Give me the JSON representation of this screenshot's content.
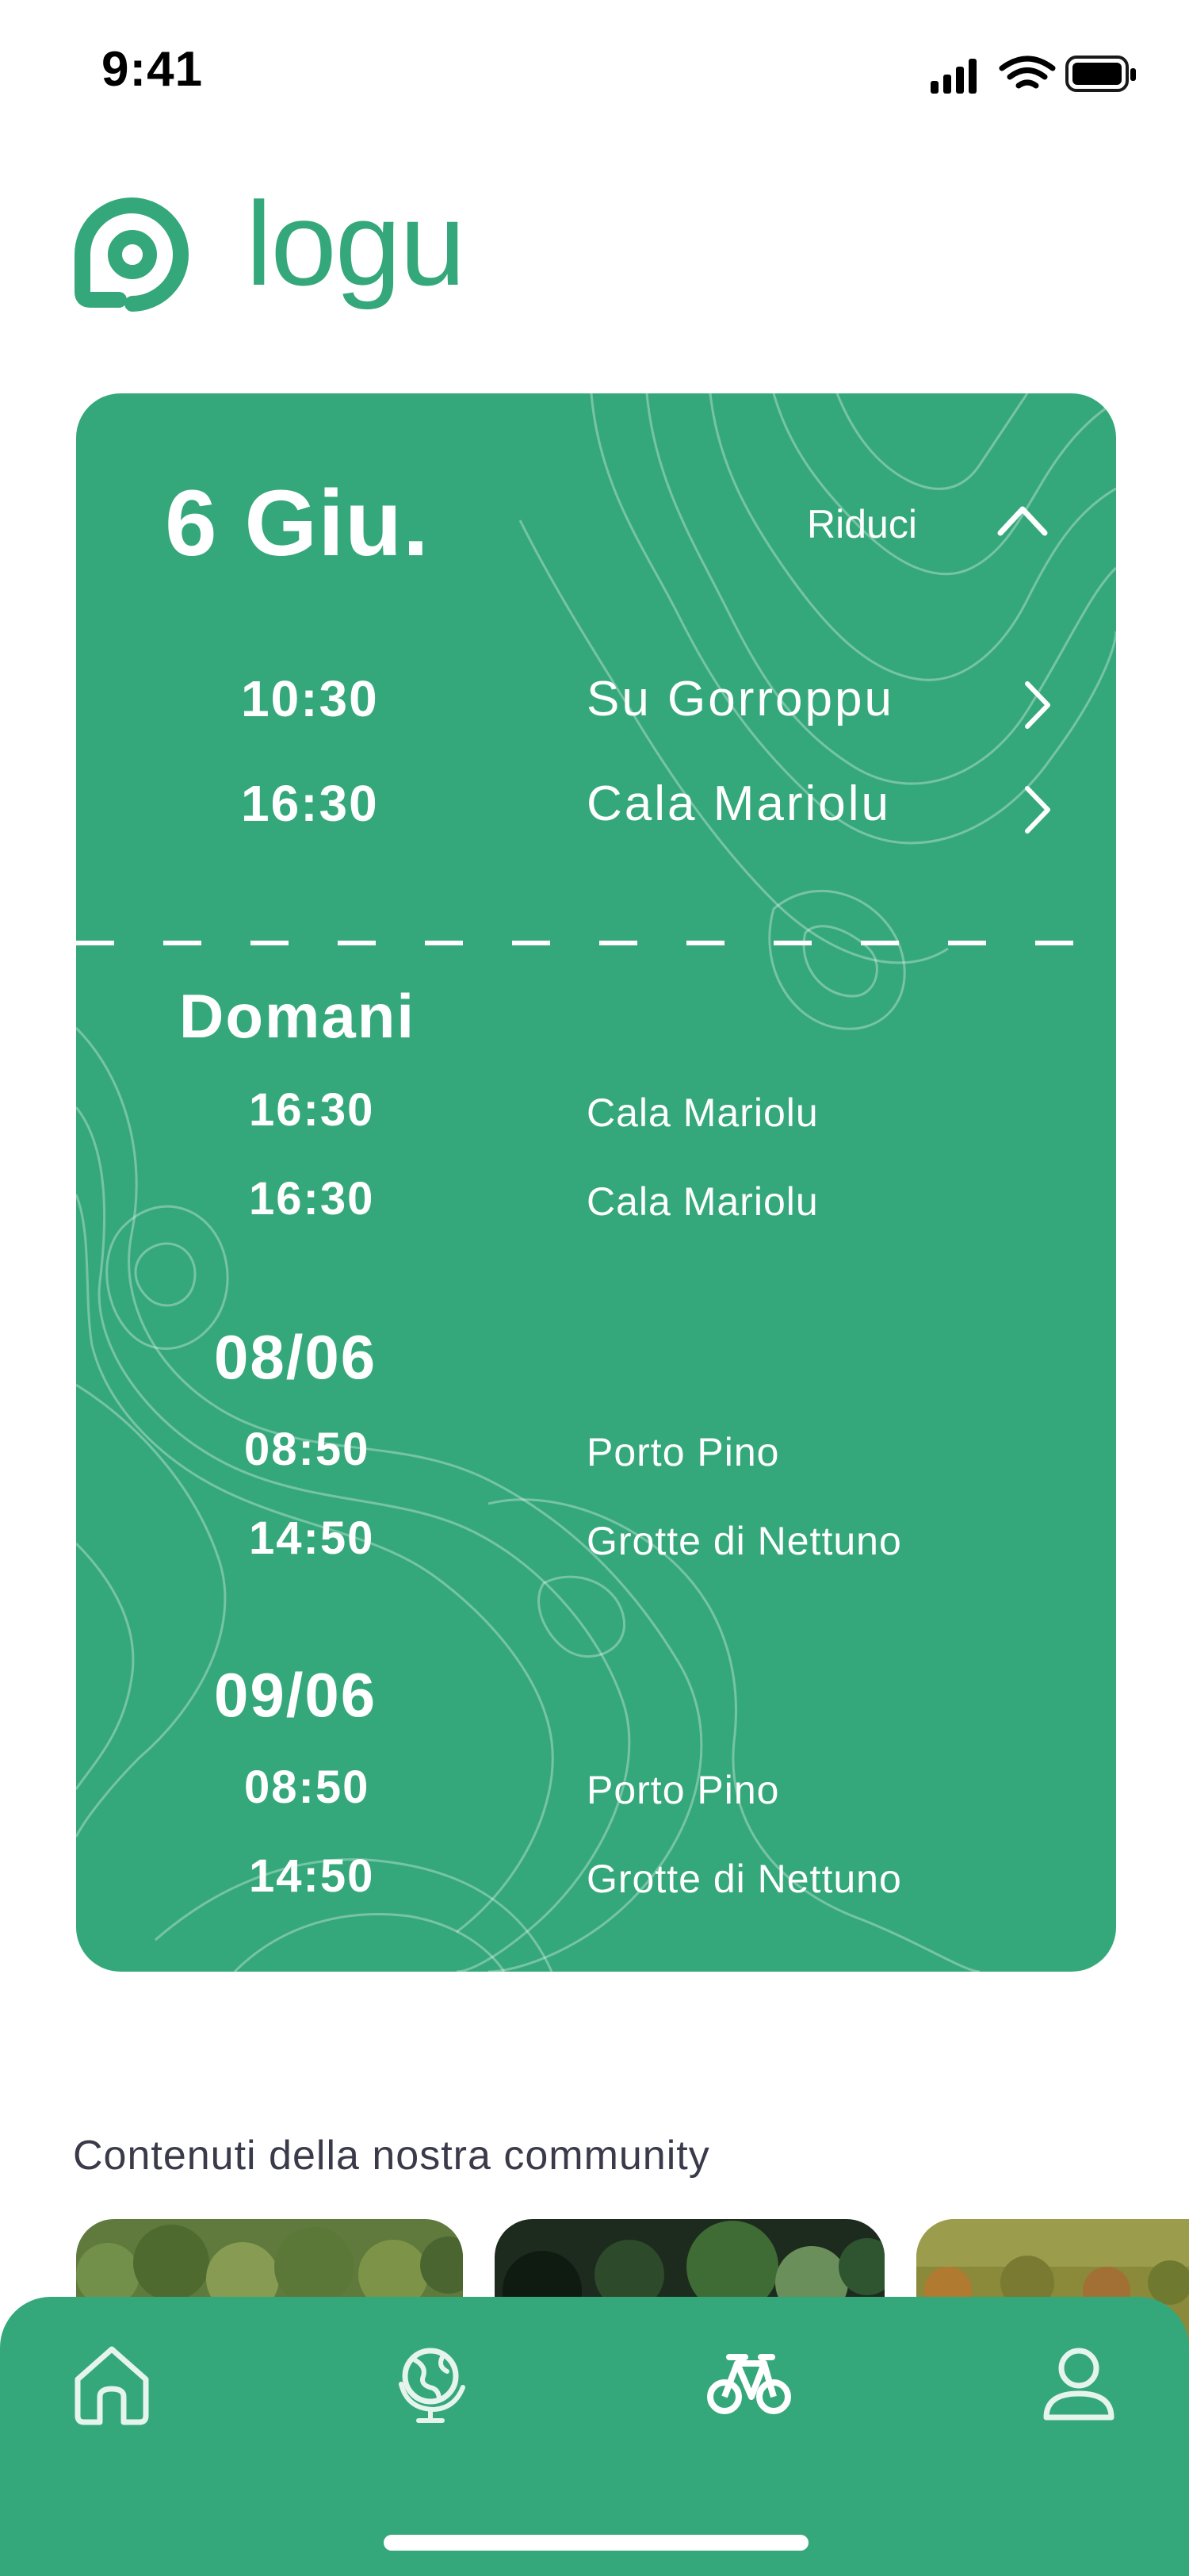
{
  "status_bar": {
    "time": "9:41"
  },
  "brand": {
    "name": "logu",
    "color": "#35a87b"
  },
  "today": {
    "date": "6 Giu.",
    "collapse_label": "Riduci",
    "items": [
      {
        "time": "10:30",
        "place": "Su Gorroppu"
      },
      {
        "time": "16:30",
        "place": "Cala Mariolu"
      }
    ]
  },
  "upcoming": [
    {
      "day": "Domani",
      "items": [
        {
          "time": "16:30",
          "place": "Cala Mariolu"
        },
        {
          "time": "16:30",
          "place": "Cala Mariolu"
        }
      ]
    },
    {
      "day": "08/06",
      "items": [
        {
          "time": "08:50",
          "place": "Porto Pino"
        },
        {
          "time": "14:50",
          "place": "Grotte di Nettuno"
        }
      ]
    },
    {
      "day": "09/06",
      "items": [
        {
          "time": "08:50",
          "place": "Porto Pino"
        },
        {
          "time": "14:50",
          "place": "Grotte di Nettuno"
        }
      ]
    }
  ],
  "community": {
    "title": "Contenuti della nostra community"
  },
  "tabbar": {
    "icons": [
      "home-icon",
      "globe-icon",
      "bike-icon",
      "user-icon"
    ],
    "active": "bike-icon"
  },
  "colors": {
    "accent": "#35a87b",
    "text_dark": "#3a3a4a"
  }
}
